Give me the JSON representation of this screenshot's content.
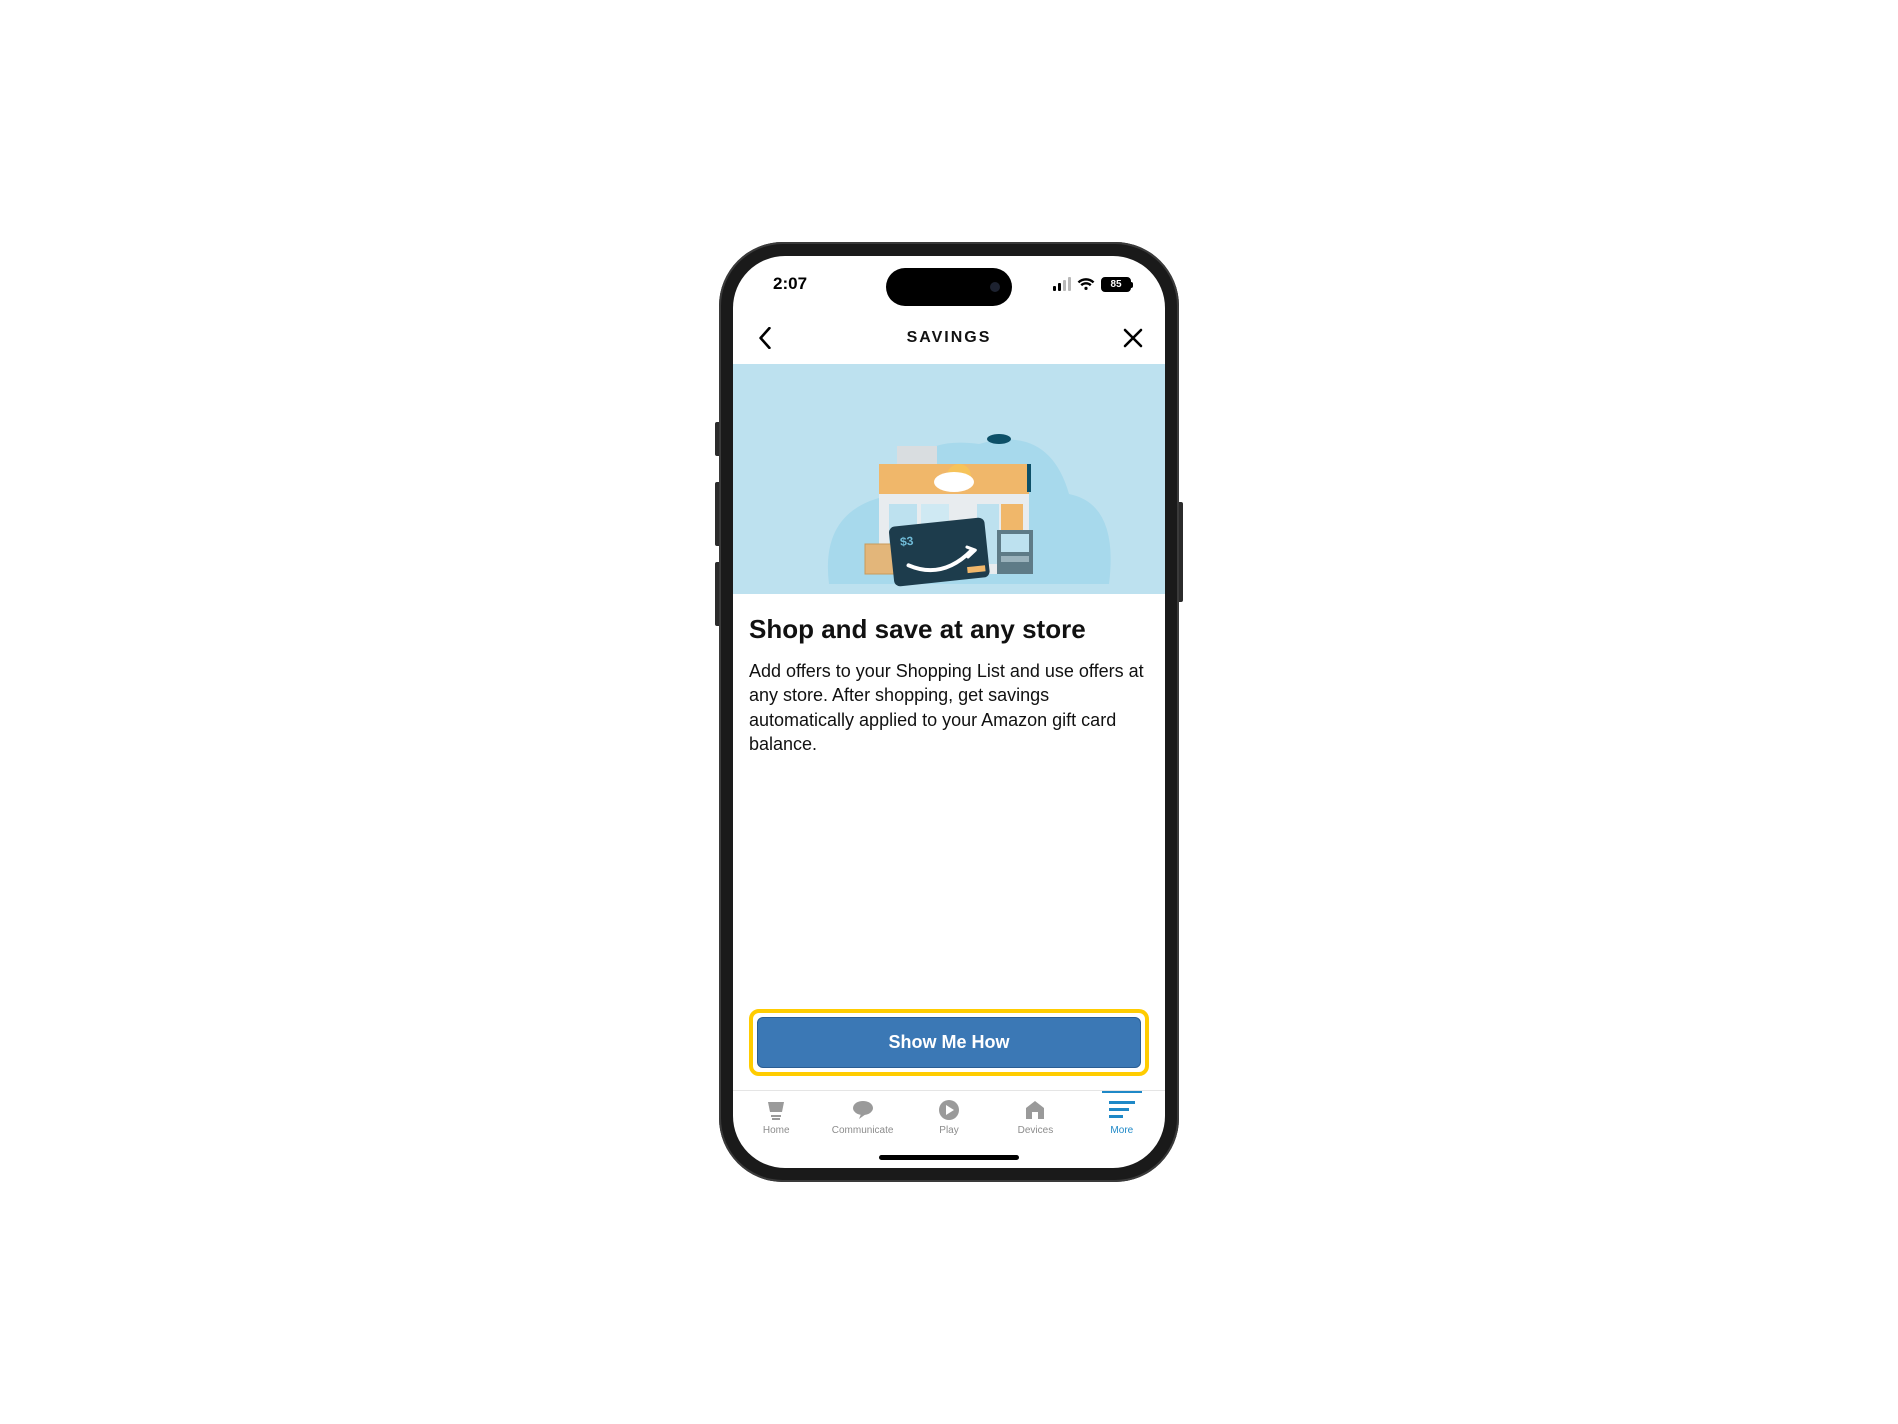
{
  "status": {
    "time": "2:07",
    "battery": "85"
  },
  "nav": {
    "title": "SAVINGS"
  },
  "hero": {
    "card_price": "$3"
  },
  "page": {
    "title": "Shop and save at any store",
    "body": "Add offers to your Shopping List and use offers at any store. After shopping, get savings automatically applied to your Amazon gift card balance.",
    "cta_label": "Show Me How"
  },
  "tabs": {
    "home": "Home",
    "communicate": "Communicate",
    "play": "Play",
    "devices": "Devices",
    "more": "More"
  }
}
